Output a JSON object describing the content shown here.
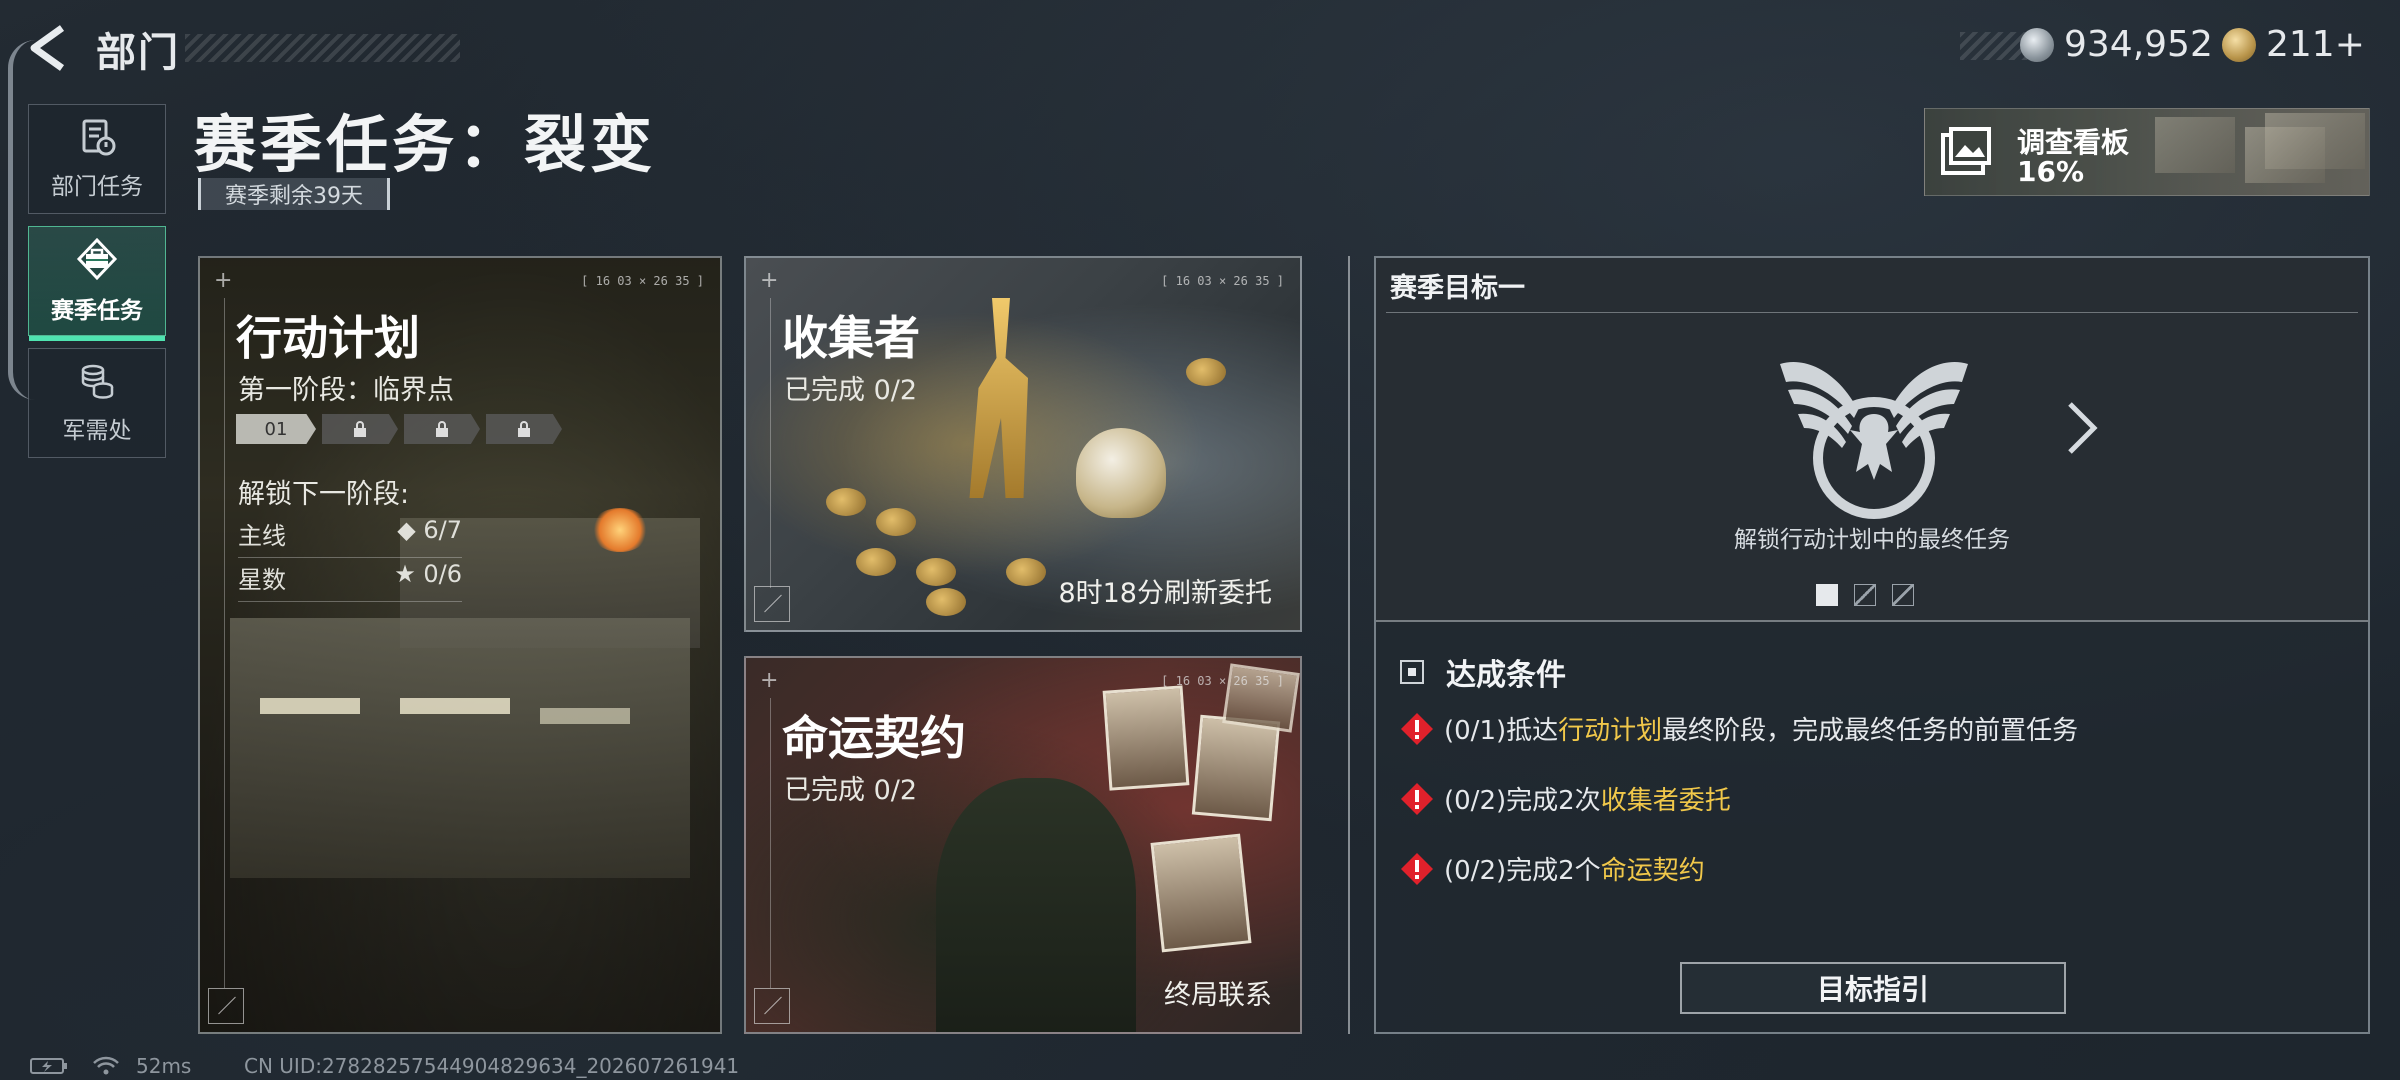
{
  "header": {
    "section_title": "部门",
    "currency": [
      {
        "icon": "silver-coin-icon",
        "value": "934,952"
      },
      {
        "icon": "gold-coin-icon",
        "value": "211+"
      }
    ]
  },
  "sidebar": {
    "items": [
      {
        "label": "部门任务",
        "icon": "department-task-icon",
        "active": false
      },
      {
        "label": "赛季任务",
        "icon": "season-task-icon",
        "active": true
      },
      {
        "label": "军需处",
        "icon": "supply-icon",
        "active": false
      }
    ]
  },
  "main": {
    "title": "赛季任务：裂变",
    "days_left": "赛季剩余39天"
  },
  "investigation": {
    "title": "调查看板",
    "progress": "16%"
  },
  "cards": {
    "plan": {
      "coord": "[ 16 03 × 26 35 ]",
      "title": "行动计划",
      "stage": "第一阶段：临界点",
      "stages": [
        "01",
        "",
        "",
        ""
      ],
      "unlock": "解锁下一阶段:",
      "rows": [
        {
          "label": "主线",
          "icon": "diamond-icon",
          "value": "◆ 6/7"
        },
        {
          "label": "星数",
          "icon": "star-icon",
          "value": "★ 0/6"
        }
      ]
    },
    "collector": {
      "coord": "[ 16 03 × 26 35 ]",
      "title": "收集者",
      "progress": "已完成 0/2",
      "footer": "8时18分刷新委托"
    },
    "fate": {
      "coord": "[ 16 03 × 26 35 ]",
      "title": "命运契约",
      "progress": "已完成 0/2",
      "footer": "终局联系"
    }
  },
  "goal": {
    "title": "赛季目标一",
    "description": "解锁行动计划中的最终任务",
    "page_count": 3,
    "current_page": 1,
    "conditions_title": "达成条件",
    "conditions": [
      {
        "prefix": "(0/1)抵达",
        "highlight": "行动计划",
        "suffix": "最终阶段，完成最终任务的前置任务"
      },
      {
        "prefix": "(0/2)完成2次",
        "highlight": "收集者委托",
        "suffix": ""
      },
      {
        "prefix": "(0/2)完成2个",
        "highlight": "命运契约",
        "suffix": ""
      }
    ],
    "button": "目标指引"
  },
  "footer": {
    "ping": "52ms",
    "uid": "CN UID:27828257544904829634_202607261941"
  },
  "colors": {
    "accent": "#4fe3b0",
    "highlight": "#f1c84a",
    "warning": "#e0212b"
  }
}
